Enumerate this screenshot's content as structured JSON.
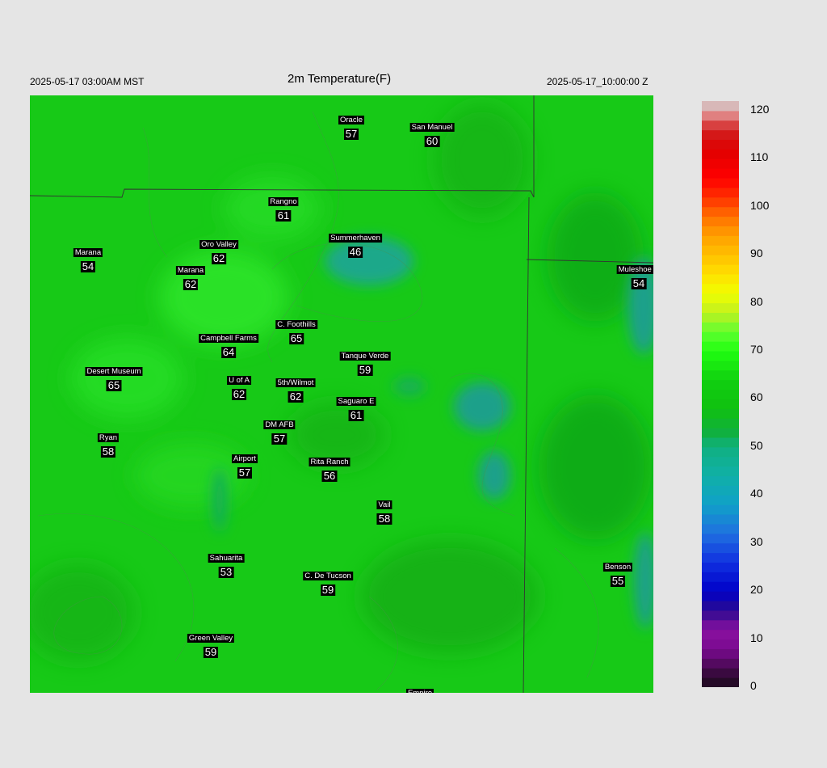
{
  "header": {
    "valid_local": "2025-05-17 03:00AM MST",
    "title": "2m Temperature(F)",
    "valid_utc": "2025-05-17_10:00:00 Z"
  },
  "colors": {
    "background": "#e5e5e5",
    "base_field": "#17c917",
    "station_label_bg": "#000000",
    "station_label_text": "#ffffff"
  },
  "stations": [
    {
      "name": "Oracle",
      "temp": "57"
    },
    {
      "name": "San Manuel",
      "temp": "60"
    },
    {
      "name": "Rangno",
      "temp": "61"
    },
    {
      "name": "Summerhaven",
      "temp": "46"
    },
    {
      "name": "Marana",
      "temp": "54"
    },
    {
      "name": "Oro Valley",
      "temp": "62"
    },
    {
      "name": "Marana",
      "temp": "62"
    },
    {
      "name": "Muleshoe R",
      "temp": "54"
    },
    {
      "name": "C. Foothills",
      "temp": "65"
    },
    {
      "name": "Campbell Farms",
      "temp": "64"
    },
    {
      "name": "Tanque Verde",
      "temp": "59"
    },
    {
      "name": "Desert Museum",
      "temp": "65"
    },
    {
      "name": "U of A",
      "temp": "62"
    },
    {
      "name": "5th/Wilmot",
      "temp": "62"
    },
    {
      "name": "Saguaro E",
      "temp": "61"
    },
    {
      "name": "DM AFB",
      "temp": "57"
    },
    {
      "name": "Ryan",
      "temp": "58"
    },
    {
      "name": "Airport",
      "temp": "57"
    },
    {
      "name": "Rita Ranch",
      "temp": "56"
    },
    {
      "name": "Vail",
      "temp": "58"
    },
    {
      "name": "Sahuarita",
      "temp": "53"
    },
    {
      "name": "C. De Tucson",
      "temp": "59"
    },
    {
      "name": "Benson",
      "temp": "55"
    },
    {
      "name": "Green Valley",
      "temp": "59"
    },
    {
      "name": "Empire",
      "temp": ""
    }
  ],
  "colorbar": {
    "ticks": [
      "120",
      "110",
      "100",
      "90",
      "80",
      "70",
      "60",
      "50",
      "40",
      "30",
      "20",
      "10",
      "0"
    ],
    "range": [
      0,
      122
    ]
  }
}
